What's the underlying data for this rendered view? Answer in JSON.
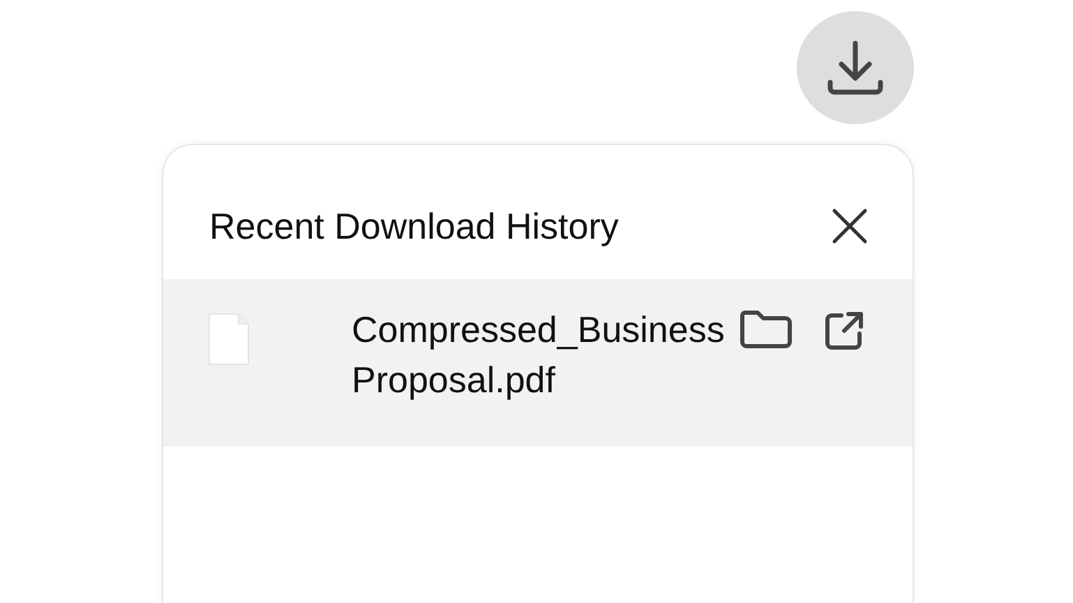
{
  "panel": {
    "title": "Recent Download History"
  },
  "downloads": [
    {
      "file_name": "Compressed_Business Proposal.pdf"
    }
  ]
}
